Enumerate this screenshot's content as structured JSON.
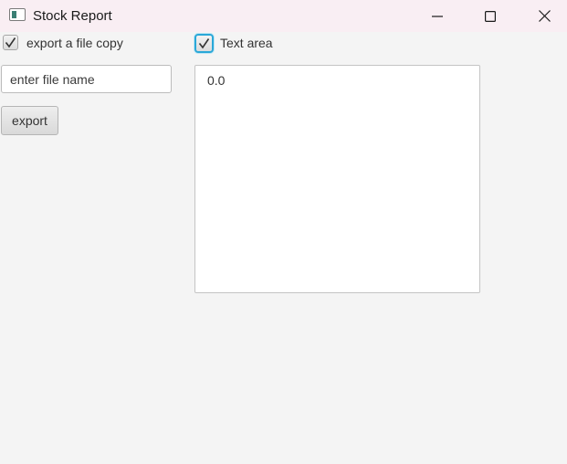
{
  "window": {
    "title": "Stock Report",
    "icon": "app-window-icon",
    "controls": [
      "minimize-icon",
      "maximize-icon",
      "close-icon"
    ]
  },
  "export_checkbox": {
    "label": "export a file copy",
    "checked": true
  },
  "text_area_checkbox": {
    "label": "Text area",
    "checked": true,
    "focused": true
  },
  "file_name": {
    "placeholder": "enter file name",
    "value": ""
  },
  "export_button": {
    "label": "export"
  },
  "text_area": {
    "content": "0.0"
  },
  "colors": {
    "titlebar": "#f9eef3",
    "background": "#f4f4f4",
    "focus_ring": "#2aa8d8"
  }
}
